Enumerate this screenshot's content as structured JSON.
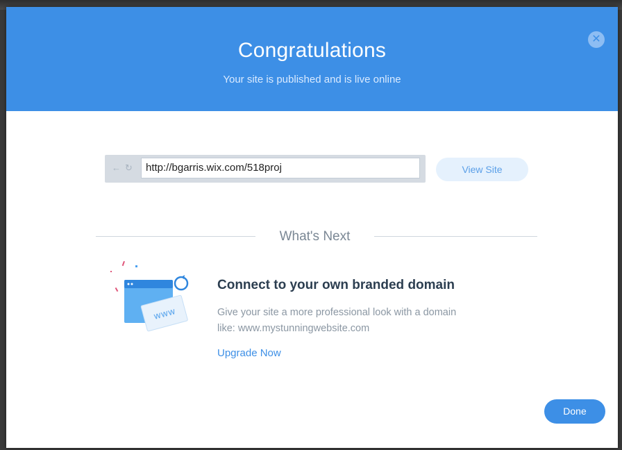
{
  "dialog": {
    "title": "Congratulations",
    "subtitle": "Your site is published and is live online",
    "close_icon": "close-icon",
    "header_color": "#3d8fe6"
  },
  "url_bar": {
    "back_icon": "←",
    "refresh_icon": "↻",
    "url": "http://bgarris.wix.com/518proj",
    "view_site_label": "View Site"
  },
  "whats_next": {
    "heading": "What's Next",
    "illustration_icon": "browser-domain-icon",
    "illustration_text": "www",
    "promo_title": "Connect to your own branded domain",
    "promo_desc_line1": "Give your site a more professional look with a domain",
    "promo_desc_line2": "like: www.mystunningwebsite.com",
    "upgrade_label": "Upgrade Now"
  },
  "footer": {
    "done_label": "Done"
  }
}
